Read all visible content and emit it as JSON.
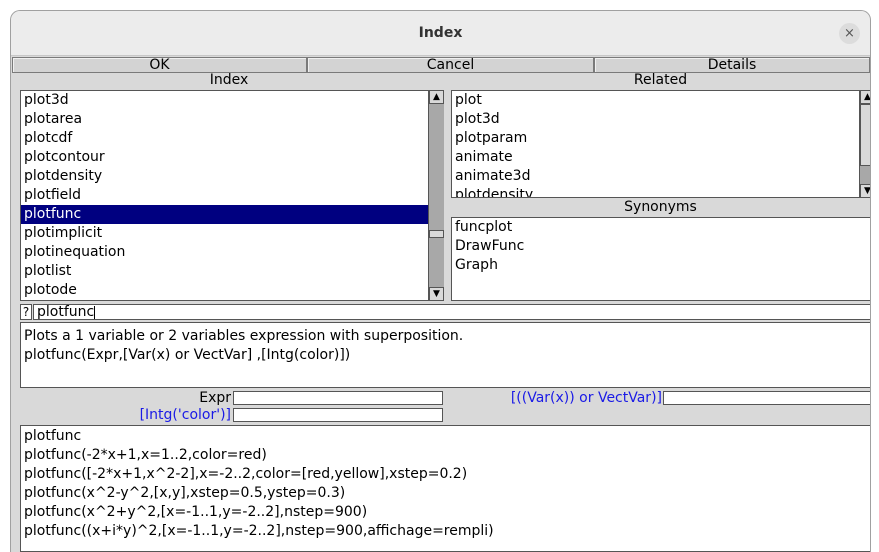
{
  "window": {
    "title": "Index",
    "close_symbol": "×"
  },
  "buttons": {
    "ok": "OK",
    "cancel": "Cancel",
    "details": "Details"
  },
  "headers": {
    "index": "Index",
    "related": "Related",
    "synonyms": "Synonyms"
  },
  "index_list": {
    "items": [
      "plot3d",
      "plotarea",
      "plotcdf",
      "plotcontour",
      "plotdensity",
      "plotfield",
      "plotfunc",
      "plotimplicit",
      "plotinequation",
      "plotlist",
      "plotode"
    ],
    "selected": "plotfunc"
  },
  "related_list": {
    "items": [
      "plot",
      "plot3d",
      "plotparam",
      "animate",
      "animate3d",
      "plotdensity"
    ]
  },
  "synonyms_list": {
    "items": [
      "funcplot",
      "DrawFunc",
      "Graph"
    ]
  },
  "search": {
    "help_symbol": "?",
    "value": "plotfunc"
  },
  "description": {
    "lines": [
      "Plots a 1 variable or 2 variables expression with superposition.",
      "plotfunc(Expr,[Var(x) or VectVar] ,[Intg(color)])"
    ]
  },
  "params": {
    "expr_label": "Expr",
    "var_label": "[((Var(x)) or VectVar)]",
    "color_label": "[Intg('color')]",
    "expr_value": "",
    "var_value": "",
    "color_value": ""
  },
  "examples": {
    "lines": [
      "plotfunc",
      "plotfunc(-2*x+1,x=1..2,color=red)",
      "plotfunc([-2*x+1,x^2-2],x=-2..2,color=[red,yellow],xstep=0.2)",
      "plotfunc(x^2-y^2,[x,y],xstep=0.5,ystep=0.3)",
      "plotfunc(x^2+y^2,[x=-1..1,y=-2..2],nstep=900)",
      "plotfunc((x+i*y)^2,[x=-1..1,y=-2..2],nstep=900,affichage=rempli)"
    ]
  },
  "colors": {
    "selection": "#000080",
    "param_label_blue": "#1a1ae6",
    "window_bg": "#d9d9d9"
  }
}
